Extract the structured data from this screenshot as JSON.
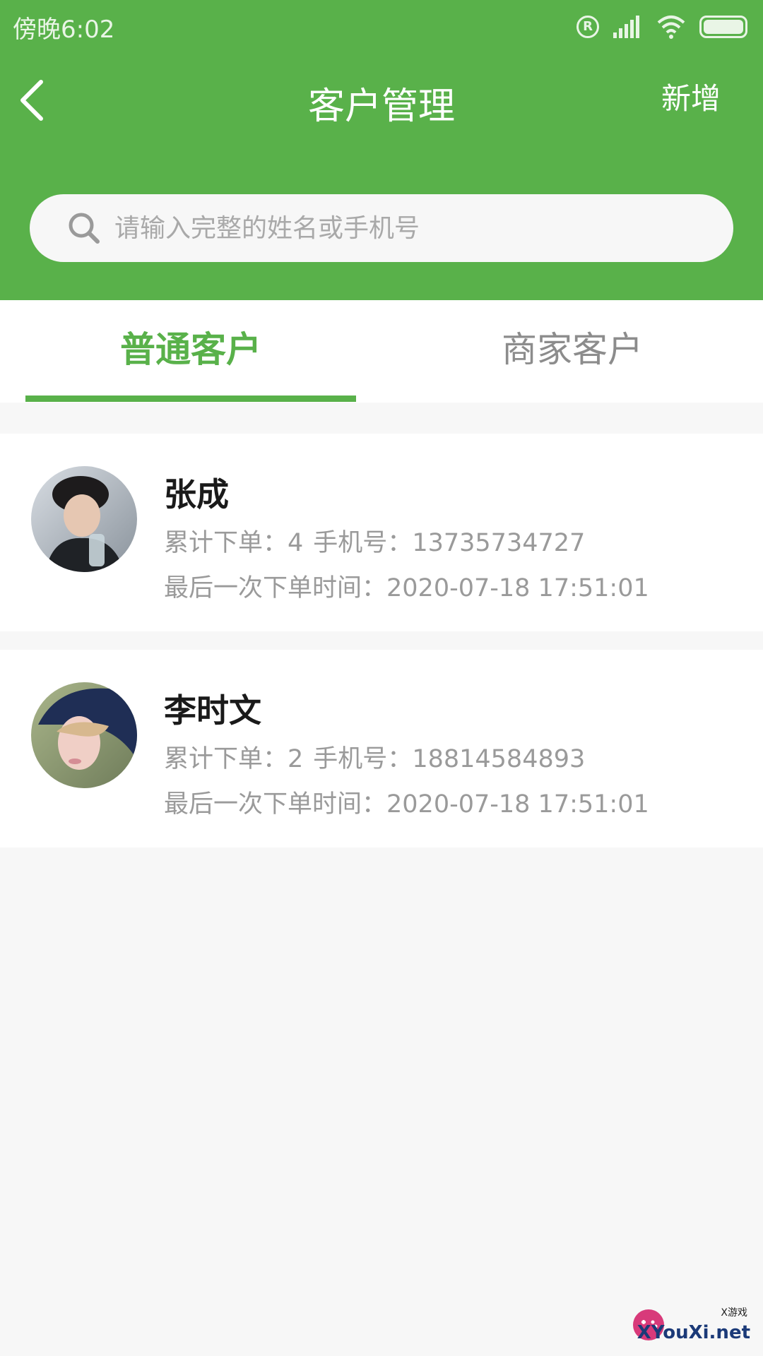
{
  "status_bar": {
    "time": "傍晚6:02",
    "registered_mark": "R"
  },
  "header": {
    "title": "客户管理",
    "add_label": "新增",
    "search_placeholder": "请输入完整的姓名或手机号"
  },
  "tabs": [
    {
      "label": "普通客户",
      "active": true
    },
    {
      "label": "商家客户",
      "active": false
    }
  ],
  "customers": [
    {
      "name": "张成",
      "order_count_label": "累计下单：",
      "order_count": "4",
      "phone_label": "手机号：",
      "phone": "13735734727",
      "last_order_label": "最后一次下单时间：",
      "last_order_time": "2020-07-18 17:51:01"
    },
    {
      "name": "李时文",
      "order_count_label": "累计下单：",
      "order_count": "2",
      "phone_label": "手机号：",
      "phone": "18814584893",
      "last_order_label": "最后一次下单时间：",
      "last_order_time": "2020-07-18 17:51:01"
    }
  ],
  "watermark": {
    "text": "XYouXi.net",
    "small_text": "X游戏"
  },
  "colors": {
    "accent": "#59b14a",
    "background": "#f7f7f7",
    "muted_text": "#9a9a9a"
  }
}
